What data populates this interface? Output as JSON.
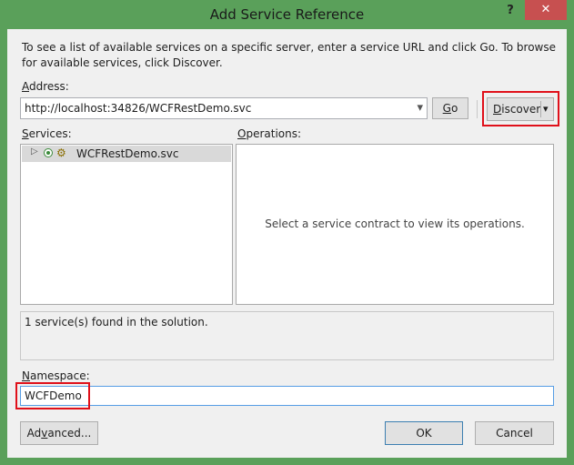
{
  "window": {
    "title": "Add Service Reference",
    "help": "?",
    "close": "✕"
  },
  "intro_text": "To see a list of available services on a specific server, enter a service URL and click Go. To browse for available services, click Discover.",
  "address": {
    "label_underlined": "A",
    "label_rest": "ddress:",
    "value": "http://localhost:34826/WCFRestDemo.svc",
    "dropdown_arrow": "▾"
  },
  "go_button": {
    "underlined": "G",
    "rest": "o"
  },
  "discover_button": {
    "underlined": "D",
    "rest": "iscover",
    "arrow": "▾"
  },
  "services": {
    "label_underlined": "S",
    "label_rest": "ervices:",
    "items": [
      {
        "name": "WCFRestDemo.svc",
        "expander": "▷"
      }
    ]
  },
  "operations": {
    "label_underlined": "O",
    "label_rest": "perations:",
    "placeholder": "Select a service contract to view its operations."
  },
  "status_text": "1 service(s) found in the solution.",
  "namespace": {
    "label_underlined": "N",
    "label_rest": "amespace:",
    "value": "WCFDemo"
  },
  "advanced_button": {
    "before": "Ad",
    "underlined": "v",
    "after": "anced..."
  },
  "ok_button": {
    "label": "OK"
  },
  "cancel_button": {
    "label": "Cancel"
  },
  "colors": {
    "window_frame": "#5aa05a",
    "close_button": "#c75050",
    "highlight_box": "#e0101a"
  }
}
